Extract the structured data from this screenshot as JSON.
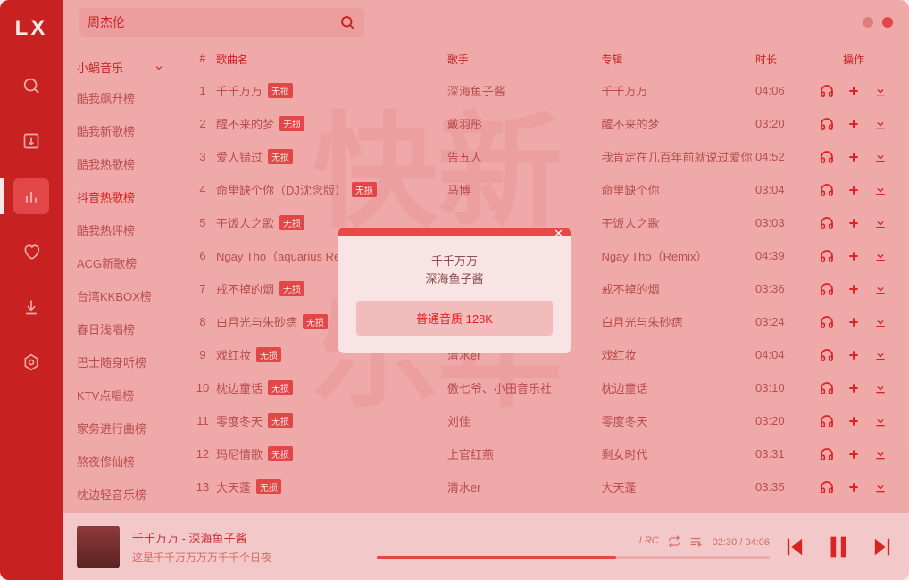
{
  "logo": "LX",
  "search": {
    "value": "周杰伦"
  },
  "source": {
    "label": "小蜗音乐"
  },
  "playlists": [
    "酷我飙升榜",
    "酷我新歌榜",
    "酷我热歌榜",
    "抖音热歌榜",
    "酷我热评榜",
    "ACG新歌榜",
    "台湾KKBOX榜",
    "春日浅唱榜",
    "巴士随身听榜",
    "KTV点唱榜",
    "家务进行曲榜",
    "熬夜修仙榜",
    "枕边轻音乐榜"
  ],
  "playlists_active": 3,
  "headers": {
    "idx": "#",
    "name": "歌曲名",
    "artist": "歌手",
    "album": "专辑",
    "dur": "时长",
    "ops": "操作"
  },
  "badge": "无损",
  "songs": [
    {
      "idx": "1",
      "name": "千千万万",
      "artist": "深海鱼子酱",
      "album": "千千万万",
      "dur": "04:06"
    },
    {
      "idx": "2",
      "name": "醒不来的梦",
      "artist": "戴羽彤",
      "album": "醒不来的梦",
      "dur": "03:20"
    },
    {
      "idx": "3",
      "name": "爱人错过",
      "artist": "告五人",
      "album": "我肯定在几百年前就说过爱你",
      "dur": "04:52"
    },
    {
      "idx": "4",
      "name": "命里缺个你（DJ沈念版）",
      "artist": "马博",
      "album": "命里缺个你",
      "dur": "03:04"
    },
    {
      "idx": "5",
      "name": "干饭人之歌",
      "artist": "",
      "album": "干饭人之歌",
      "dur": "03:03"
    },
    {
      "idx": "6",
      "name": "Ngay Tho（aquarius Remix）",
      "artist": "",
      "album": "Ngay Tho（Remix）",
      "dur": "04:39"
    },
    {
      "idx": "7",
      "name": "戒不掉的烟",
      "artist": "",
      "album": "戒不掉的烟",
      "dur": "03:36"
    },
    {
      "idx": "8",
      "name": "白月光与朱砂痣",
      "artist": "",
      "album": "白月光与朱砂痣",
      "dur": "03:24"
    },
    {
      "idx": "9",
      "name": "戏红妆",
      "artist": "清水er",
      "album": "戏红妆",
      "dur": "04:04"
    },
    {
      "idx": "10",
      "name": "枕边童话",
      "artist": "傲七爷、小田音乐社",
      "album": "枕边童话",
      "dur": "03:10"
    },
    {
      "idx": "11",
      "name": "零度冬天",
      "artist": "刘佳",
      "album": "零度冬天",
      "dur": "03:20"
    },
    {
      "idx": "12",
      "name": "玛尼情歌",
      "artist": "上官红燕",
      "album": "剩女时代",
      "dur": "03:31"
    },
    {
      "idx": "13",
      "name": "大天蓬",
      "artist": "清水er",
      "album": "大天蓬",
      "dur": "03:35"
    }
  ],
  "modal": {
    "title": "千千万万",
    "artist": "深海鱼子酱",
    "quality": "普通音质 128K"
  },
  "player": {
    "title": "千千万万 - 深海鱼子酱",
    "sub": "这是千千万万万万千千个日夜",
    "time": "02:30 / 04:06",
    "lrc": "LRC"
  }
}
